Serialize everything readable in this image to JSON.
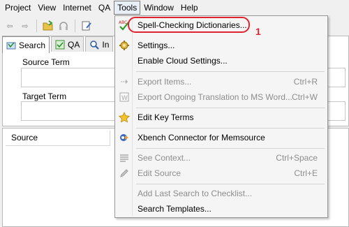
{
  "menubar": {
    "items": [
      "Project",
      "View",
      "Internet",
      "QA",
      "Tools",
      "Window",
      "Help"
    ]
  },
  "tabs": {
    "search": "Search",
    "qa": "QA",
    "third": "In"
  },
  "panel": {
    "source_term_label": "Source Term",
    "target_term_label": "Target Term",
    "source_column": "Source"
  },
  "tools_menu": {
    "spell_checking": "Spell-Checking Dictionaries...",
    "settings": "Settings...",
    "enable_cloud": "Enable Cloud Settings...",
    "export_items": "Export Items...",
    "export_items_sc": "Ctrl+R",
    "export_ongoing": "Export Ongoing Translation to MS Word...",
    "export_ongoing_sc": "Ctrl+W",
    "edit_key_terms": "Edit Key Terms",
    "xbench_connector": "Xbench Connector for Memsource",
    "see_context": "See Context...",
    "see_context_sc": "Ctrl+Space",
    "edit_source": "Edit Source",
    "edit_source_sc": "Ctrl+E",
    "add_last_search": "Add Last Search to Checklist...",
    "search_templates": "Search Templates..."
  },
  "annotation": {
    "number": "1",
    "color": "#e0242f"
  }
}
